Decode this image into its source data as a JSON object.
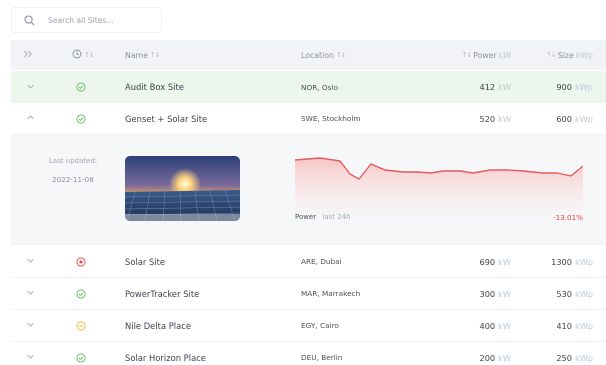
{
  "search": {
    "placeholder": "Search all Sites...",
    "value": ""
  },
  "header": {
    "expand_icon": "double-chevron-right-icon",
    "status_icon": "clock-icon",
    "name_label": "Name",
    "location_label": "Location",
    "power_label": "Power",
    "power_unit": "kW",
    "size_label": "Size",
    "size_unit": "kWp"
  },
  "rows": [
    {
      "name": "Audit Box Site",
      "location": "NOR, Oslo",
      "power": "412",
      "power_unit": "kW",
      "size": "900",
      "size_unit": "kWp",
      "status": "ok",
      "expanded": false
    },
    {
      "name": "Genset + Solar Site",
      "location": "SWE, Stockholm",
      "power": "520",
      "power_unit": "kW",
      "size": "600",
      "size_unit": "kWp",
      "status": "ok",
      "expanded": true
    },
    {
      "name": "Solar Site",
      "location": "ARE, Dubai",
      "power": "690",
      "power_unit": "kW",
      "size": "1300",
      "size_unit": "kWp",
      "status": "error",
      "expanded": false
    },
    {
      "name": "PowerTracker Site",
      "location": "MAR, Marrakech",
      "power": "300",
      "power_unit": "kW",
      "size": "530",
      "size_unit": "kWp",
      "status": "ok",
      "expanded": false
    },
    {
      "name": "Nile Delta Place",
      "location": "EGY, Cairo",
      "power": "400",
      "power_unit": "kW",
      "size": "410",
      "size_unit": "kWp",
      "status": "warning",
      "expanded": false
    },
    {
      "name": "Solar Horizon Place",
      "location": "DEU, Berlin",
      "power": "200",
      "power_unit": "kW",
      "size": "250",
      "size_unit": "kWp",
      "status": "ok",
      "expanded": false
    }
  ],
  "details": {
    "last_updated_label": "Last updated:",
    "last_updated_date": "2022-11-08",
    "power_label": "Power",
    "power_sub": "last 24h",
    "change": "-13.01%"
  },
  "colors": {
    "ok": "#5cb85c",
    "error": "#e04444",
    "warning": "#f0b429",
    "highlight_row": "#ecf6ec",
    "chart_line": "#e85a5a",
    "unit_text": "#b8c8dc"
  }
}
